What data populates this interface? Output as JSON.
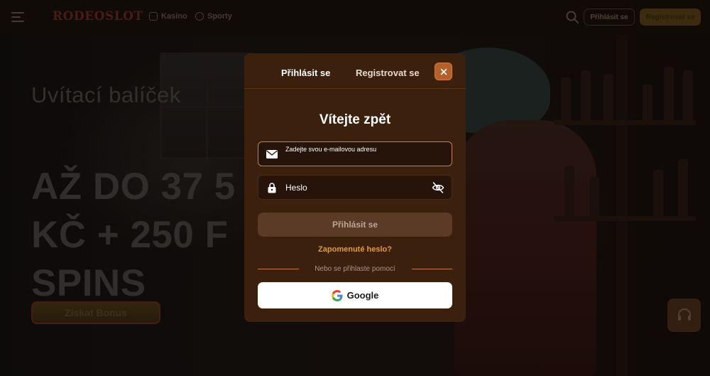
{
  "header": {
    "logo": "RODEOSLOT",
    "nav": [
      {
        "label": "Kasino"
      },
      {
        "label": "Sporty"
      }
    ],
    "login_label": "Přihlásit se",
    "register_label": "Registrovat se"
  },
  "hero": {
    "subtitle": "Uvítací balíček",
    "line1": "AŽ DO 37 5",
    "line2": "KČ + 250 F",
    "line3": "SPINS",
    "cta": "Získat Bonus"
  },
  "modal": {
    "tabs": {
      "login": "Přihlásit se",
      "register": "Registrovat se"
    },
    "title": "Vítejte zpět",
    "email": {
      "placeholder": "Zadejte svou e-mailovou adresu",
      "value": ""
    },
    "password": {
      "placeholder": "Heslo",
      "value": ""
    },
    "submit": "Přihlásit se",
    "forgot": "Zapomenuté heslo?",
    "divider": "Nebo se přihlaste pomocí",
    "google": "Google"
  },
  "colors": {
    "accent": "#e39a3a",
    "modal_bg": "#3c200e",
    "close_bg": "#b4602a"
  },
  "icons": [
    "menu-icon",
    "casino-icon",
    "sport-icon",
    "search-icon",
    "close-icon",
    "mail-icon",
    "lock-icon",
    "eye-off-icon",
    "google-icon",
    "headset-icon"
  ]
}
